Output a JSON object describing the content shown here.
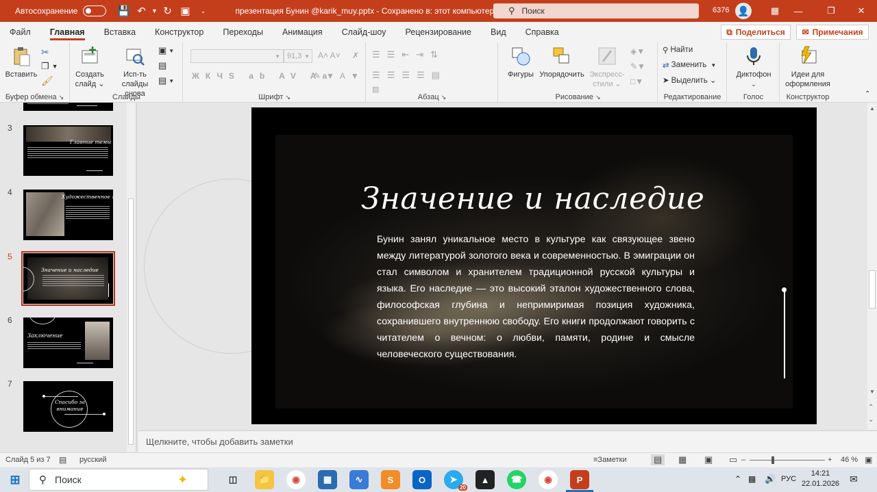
{
  "titlebar": {
    "autosave_label": "Автосохранение",
    "doc_title": "презентация Бунин @karik_muy.pptx  -  Сохранено в: этот компьютер  ⌄",
    "search_placeholder": "Поиск",
    "user_count": "6376"
  },
  "tabs": [
    "Файл",
    "Главная",
    "Вставка",
    "Конструктор",
    "Переходы",
    "Анимация",
    "Слайд-шоу",
    "Рецензирование",
    "Вид",
    "Справка"
  ],
  "actions": {
    "share": "Поделиться",
    "comments": "Примечания"
  },
  "ribbon": {
    "groups": {
      "clipboard": "Буфер обмена",
      "slides": "Слайды",
      "font": "Шрифт",
      "paragraph": "Абзац",
      "drawing": "Рисование",
      "editing": "Редактирование",
      "voice": "Голос",
      "designer": "Конструктор"
    },
    "paste": "Вставить",
    "new_slide": "Создать слайд ⌄",
    "reuse_slides": "Исп-ть слайды снова",
    "font_size": "91,3",
    "shapes": "Фигуры",
    "arrange": "Упорядочить",
    "styles": "Экспресс-стили ⌄",
    "find": "Найти",
    "replace": "Заменить",
    "select": "Выделить ⌄",
    "dictate": "Диктофон",
    "design_ideas": "Идеи для оформления"
  },
  "thumbnails": [
    {
      "num": "3",
      "title": "Главные темы творчества"
    },
    {
      "num": "4",
      "title": "Художественное мастерство"
    },
    {
      "num": "5",
      "title": "Значение и наследие"
    },
    {
      "num": "6",
      "title": "Заключение"
    },
    {
      "num": "7",
      "title": "Спасибо за внимание"
    }
  ],
  "slide": {
    "title": "Значение и наследие",
    "body": "Бунин занял уникальное место в культуре как связующее звено между литературой золотого века и современностью. В эмиграции он стал символом и хранителем традиционной русской культуры и языка. Его наследие — это высокий эталон художественного слова, философская глубина и непримиримая позиция художника, сохранившего внутреннюю свободу. Его книги продолжают говорить с читателем о вечном: о любви, памяти, родине и смысле человеческого существования."
  },
  "notes_placeholder": "Щелкните, чтобы добавить заметки",
  "status": {
    "slide_of": "Слайд 5 из 7",
    "language": "русский",
    "notes": "Заметки",
    "zoom": "46 %"
  },
  "taskbar": {
    "search_placeholder": "Поиск",
    "tray_lang": "РУС",
    "time": "14:21",
    "date": "22.01.2026",
    "telegram_badge": "20"
  },
  "colors": {
    "accent": "#c43e1c",
    "slide_bg": "#000000"
  }
}
